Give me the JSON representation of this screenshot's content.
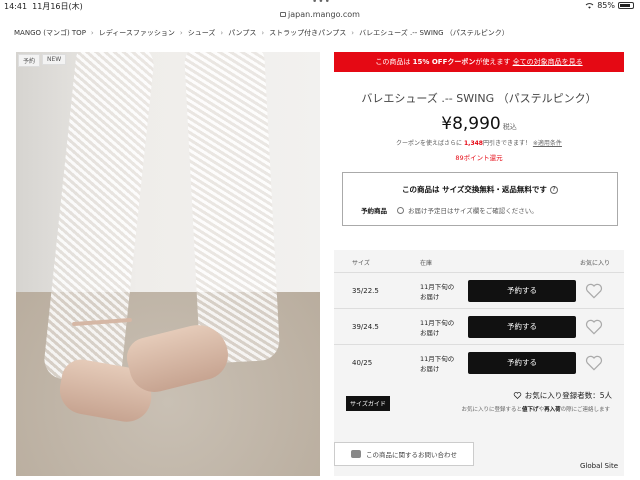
{
  "status": {
    "time": "14:41",
    "date": "11月16日(木)",
    "battery": "85%",
    "battery_level": 0.85
  },
  "browser": {
    "url": "japan.mango.com"
  },
  "breadcrumb": [
    "MANGO (マンゴ) TOP",
    "レディースファッション",
    "シューズ",
    "パンプス",
    "ストラップ付きパンプス",
    "バレエシューズ .-- SWING （パステルピンク）"
  ],
  "image": {
    "tags": [
      "予約",
      "NEW"
    ]
  },
  "promo": {
    "prefix": "この商品は",
    "highlight": "15% OFFクーポン",
    "suffix": "が使えます",
    "link": "全ての対象商品を見る"
  },
  "product": {
    "title": "バレエシューズ .-- SWING （パステルピンク）",
    "price": "¥8,990",
    "tax": "税込",
    "coupon_prefix": "クーポンを使えばさらに",
    "coupon_amount": "1,348",
    "coupon_suffix": "円引きできます！",
    "coupon_conditions": "※適用条件",
    "points": "89ポイント還元"
  },
  "shipping": {
    "title": "この商品は サイズ交換無料・返品無料です",
    "help": "?",
    "label": "予約商品",
    "note": "お届け予定日はサイズ欄をご確認ください。"
  },
  "sizes": {
    "headers": {
      "size": "サイズ",
      "stock": "在庫",
      "fav": "お気に入り"
    },
    "rows": [
      {
        "size": "35/22.5",
        "stock1": "11月下旬の",
        "stock2": "お届け",
        "button": "予約する"
      },
      {
        "size": "39/24.5",
        "stock1": "11月下旬の",
        "stock2": "お届け",
        "button": "予約する"
      },
      {
        "size": "40/25",
        "stock1": "11月下旬の",
        "stock2": "お届け",
        "button": "予約する"
      }
    ],
    "size_guide": "サイズガイド",
    "fav_count": "お気に入り登録者数：5人",
    "fav_note_prefix": "お気に入りに登録すると",
    "fav_note_bold1": "値下げ",
    "fav_note_mid": "や",
    "fav_note_bold2": "再入荷",
    "fav_note_suffix": "の際にご連絡します"
  },
  "inquiry": "この商品に関するお問い合わせ",
  "footer": {
    "global_site": "Global Site"
  }
}
